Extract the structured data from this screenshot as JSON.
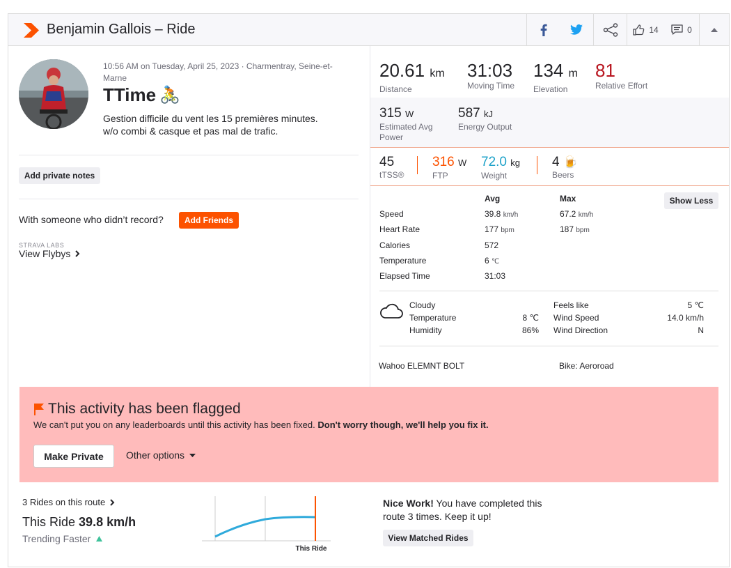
{
  "header": {
    "title": "Benjamin Gallois – Ride",
    "kudos_count": "14",
    "comment_count": "0"
  },
  "activity": {
    "date_location": "10:56 AM on Tuesday, April 25, 2023 · Charmentray, Seine-et-Marne",
    "title": "TTime",
    "title_emoji": "🚴",
    "description_line1": "Gestion difficile du vent les 15 premières minutes.",
    "description_line2": "w/o combi & casque et pas mal de trafic.",
    "private_notes_label": "Add private notes",
    "with_someone_text": "With someone who didn’t record?",
    "add_friends_label": "Add Friends",
    "labs_label": "STRAVA LABS",
    "flybys_label": "View Flybys"
  },
  "primary_stats": [
    {
      "value": "20.61",
      "unit": "km",
      "label": "Distance"
    },
    {
      "value": "31:03",
      "unit": "",
      "label": "Moving Time"
    },
    {
      "value": "134",
      "unit": "m",
      "label": "Elevation"
    },
    {
      "value": "81",
      "unit": "",
      "label": "Relative Effort"
    }
  ],
  "secondary_stats": [
    {
      "value": "315",
      "unit": "W",
      "label": "Estimated Avg Power"
    },
    {
      "value": "587",
      "unit": "kJ",
      "label": "Energy Output"
    }
  ],
  "extra_stats": [
    {
      "value": "45",
      "unit": "",
      "label": "tTSS®"
    },
    {
      "value": "316",
      "unit": "W",
      "label": "FTP"
    },
    {
      "value": "72.0",
      "unit": "kg",
      "label": "Weight"
    },
    {
      "value": "4",
      "unit": "🍺",
      "label": "Beers"
    }
  ],
  "details": {
    "avg_header": "Avg",
    "max_header": "Max",
    "show_less_label": "Show Less",
    "rows": [
      {
        "label": "Speed",
        "avg": "39.8",
        "avg_unit": "km/h",
        "max": "67.2",
        "max_unit": "km/h"
      },
      {
        "label": "Heart Rate",
        "avg": "177",
        "avg_unit": "bpm",
        "max": "187",
        "max_unit": "bpm"
      },
      {
        "label": "Calories",
        "avg": "572",
        "avg_unit": "",
        "max": "",
        "max_unit": ""
      },
      {
        "label": "Temperature",
        "avg": "6",
        "avg_unit": "℃",
        "max": "",
        "max_unit": ""
      },
      {
        "label": "Elapsed Time",
        "avg": "31:03",
        "avg_unit": "",
        "max": "",
        "max_unit": ""
      }
    ]
  },
  "weather": {
    "condition": "Cloudy",
    "temperature_label": "Temperature",
    "temperature": "8 ℃",
    "humidity_label": "Humidity",
    "humidity": "86%",
    "feels_like_label": "Feels like",
    "feels_like": "5 ℃",
    "wind_speed_label": "Wind Speed",
    "wind_speed": "14.0 km/h",
    "wind_direction_label": "Wind Direction",
    "wind_direction": "N"
  },
  "device": "Wahoo ELEMNT BOLT",
  "bike": "Bike: Aeroroad",
  "flagged": {
    "title": "This activity has been flagged",
    "text": "We can't put you on any leaderboards until this activity has been fixed.",
    "text_bold": "Don't worry though, we'll help you fix it.",
    "make_private_label": "Make Private",
    "other_options_label": "Other options"
  },
  "route": {
    "rides_label": "3 Rides on this route",
    "this_ride_label": "This Ride",
    "this_ride_value": "39.8 km/h",
    "trending_label": "Trending Faster",
    "chart_marker_label": "This Ride",
    "nice_bold": "Nice Work!",
    "nice_text": "You have completed this route 3 times. Keep it up!",
    "matched_label": "View Matched Rides"
  },
  "colors": {
    "brand": "#fc5200",
    "relative_effort": "#b8151f",
    "ftp": "#fc5200",
    "weight": "#1ea2c9",
    "flag_bg": "#ffbbbb",
    "chart_line": "#2faadb"
  }
}
